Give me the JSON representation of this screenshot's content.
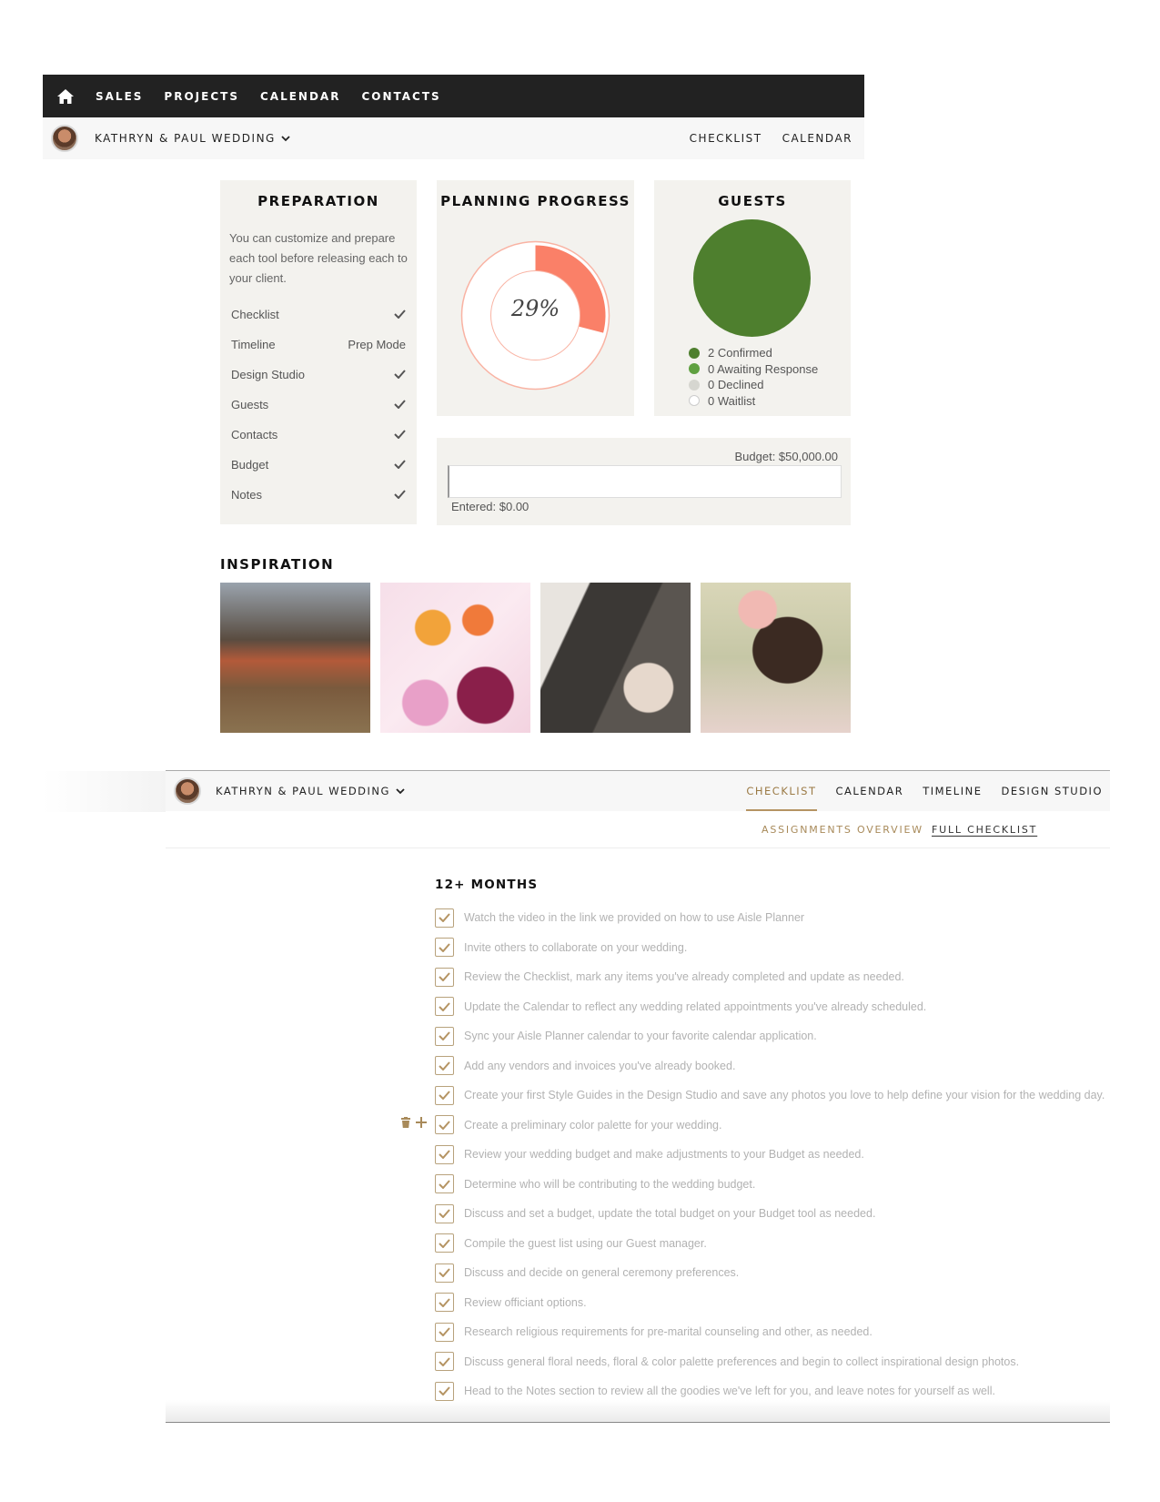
{
  "topnav": {
    "home_icon": "home-icon",
    "links": [
      "SALES",
      "PROJECTS",
      "CALENDAR",
      "CONTACTS"
    ]
  },
  "project_bar": {
    "avatar": "avatar",
    "wedding_name": "KATHRYN & PAUL WEDDING",
    "links": [
      "CHECKLIST",
      "CALENDAR"
    ]
  },
  "preparation": {
    "title": "PREPARATION",
    "description": "You can customize and prepare each tool before releasing each to your client.",
    "tools": [
      {
        "label": "Checklist",
        "status": "check"
      },
      {
        "label": "Timeline",
        "status": "Prep Mode"
      },
      {
        "label": "Design Studio",
        "status": "check"
      },
      {
        "label": "Guests",
        "status": "check"
      },
      {
        "label": "Contacts",
        "status": "check"
      },
      {
        "label": "Budget",
        "status": "check"
      },
      {
        "label": "Notes",
        "status": "check"
      }
    ]
  },
  "planning_progress": {
    "title": "PLANNING PROGRESS",
    "percent_label": "29%",
    "percent": 29,
    "colors": {
      "progress": "#fa8068",
      "ring": "#f9b3a3"
    }
  },
  "guests": {
    "title": "GUESTS",
    "legend": [
      {
        "label": "2 Confirmed",
        "color": "#4e7f2e"
      },
      {
        "label": "0 Awaiting Response",
        "color": "#5fa040"
      },
      {
        "label": "0 Declined",
        "color": "#d6d6d0"
      },
      {
        "label": "0 Waitlist",
        "color": "#ffffff"
      }
    ]
  },
  "budget": {
    "total_label": "Budget: $50,000.00",
    "entered_label": "Entered: $0.00"
  },
  "inspiration": {
    "title": "INSPIRATION"
  },
  "checklist_bar": {
    "wedding_name": "KATHRYN & PAUL WEDDING",
    "tabs": [
      "CHECKLIST",
      "CALENDAR",
      "TIMELINE",
      "DESIGN STUDIO"
    ],
    "active_tab": "CHECKLIST",
    "subtabs": [
      "ASSIGNMENTS OVERVIEW",
      "FULL CHECKLIST"
    ]
  },
  "checklist": {
    "section_title": "12+ MONTHS",
    "accent_color": "#b59463",
    "tasks": [
      "Watch the video in the link we provided on how to use Aisle Planner",
      "Invite others to collaborate on your wedding.",
      "Review the Checklist, mark any items you've already completed and update as needed.",
      "Update the Calendar to reflect any wedding related appointments you've already scheduled.",
      "Sync your Aisle Planner calendar to your favorite calendar application.",
      "Add any vendors and invoices you've already booked.",
      "Create your first Style Guides in the Design Studio and save any photos you love to help define your vision for the wedding day.",
      "Create a preliminary color palette for your wedding.",
      "Review your wedding budget and make adjustments to your Budget as needed.",
      "Determine who will be contributing to the wedding budget.",
      "Discuss and set a budget, update the total budget on your Budget tool as needed.",
      "Compile the guest list using our Guest manager.",
      "Discuss and decide on general ceremony preferences.",
      "Review officiant options.",
      "Research religious requirements for pre-marital counseling and other, as needed.",
      "Discuss general floral needs, floral & color palette preferences and begin to collect inspirational design photos.",
      "Head to the Notes section to review all the goodies we've left for you, and leave notes for yourself as well."
    ]
  }
}
